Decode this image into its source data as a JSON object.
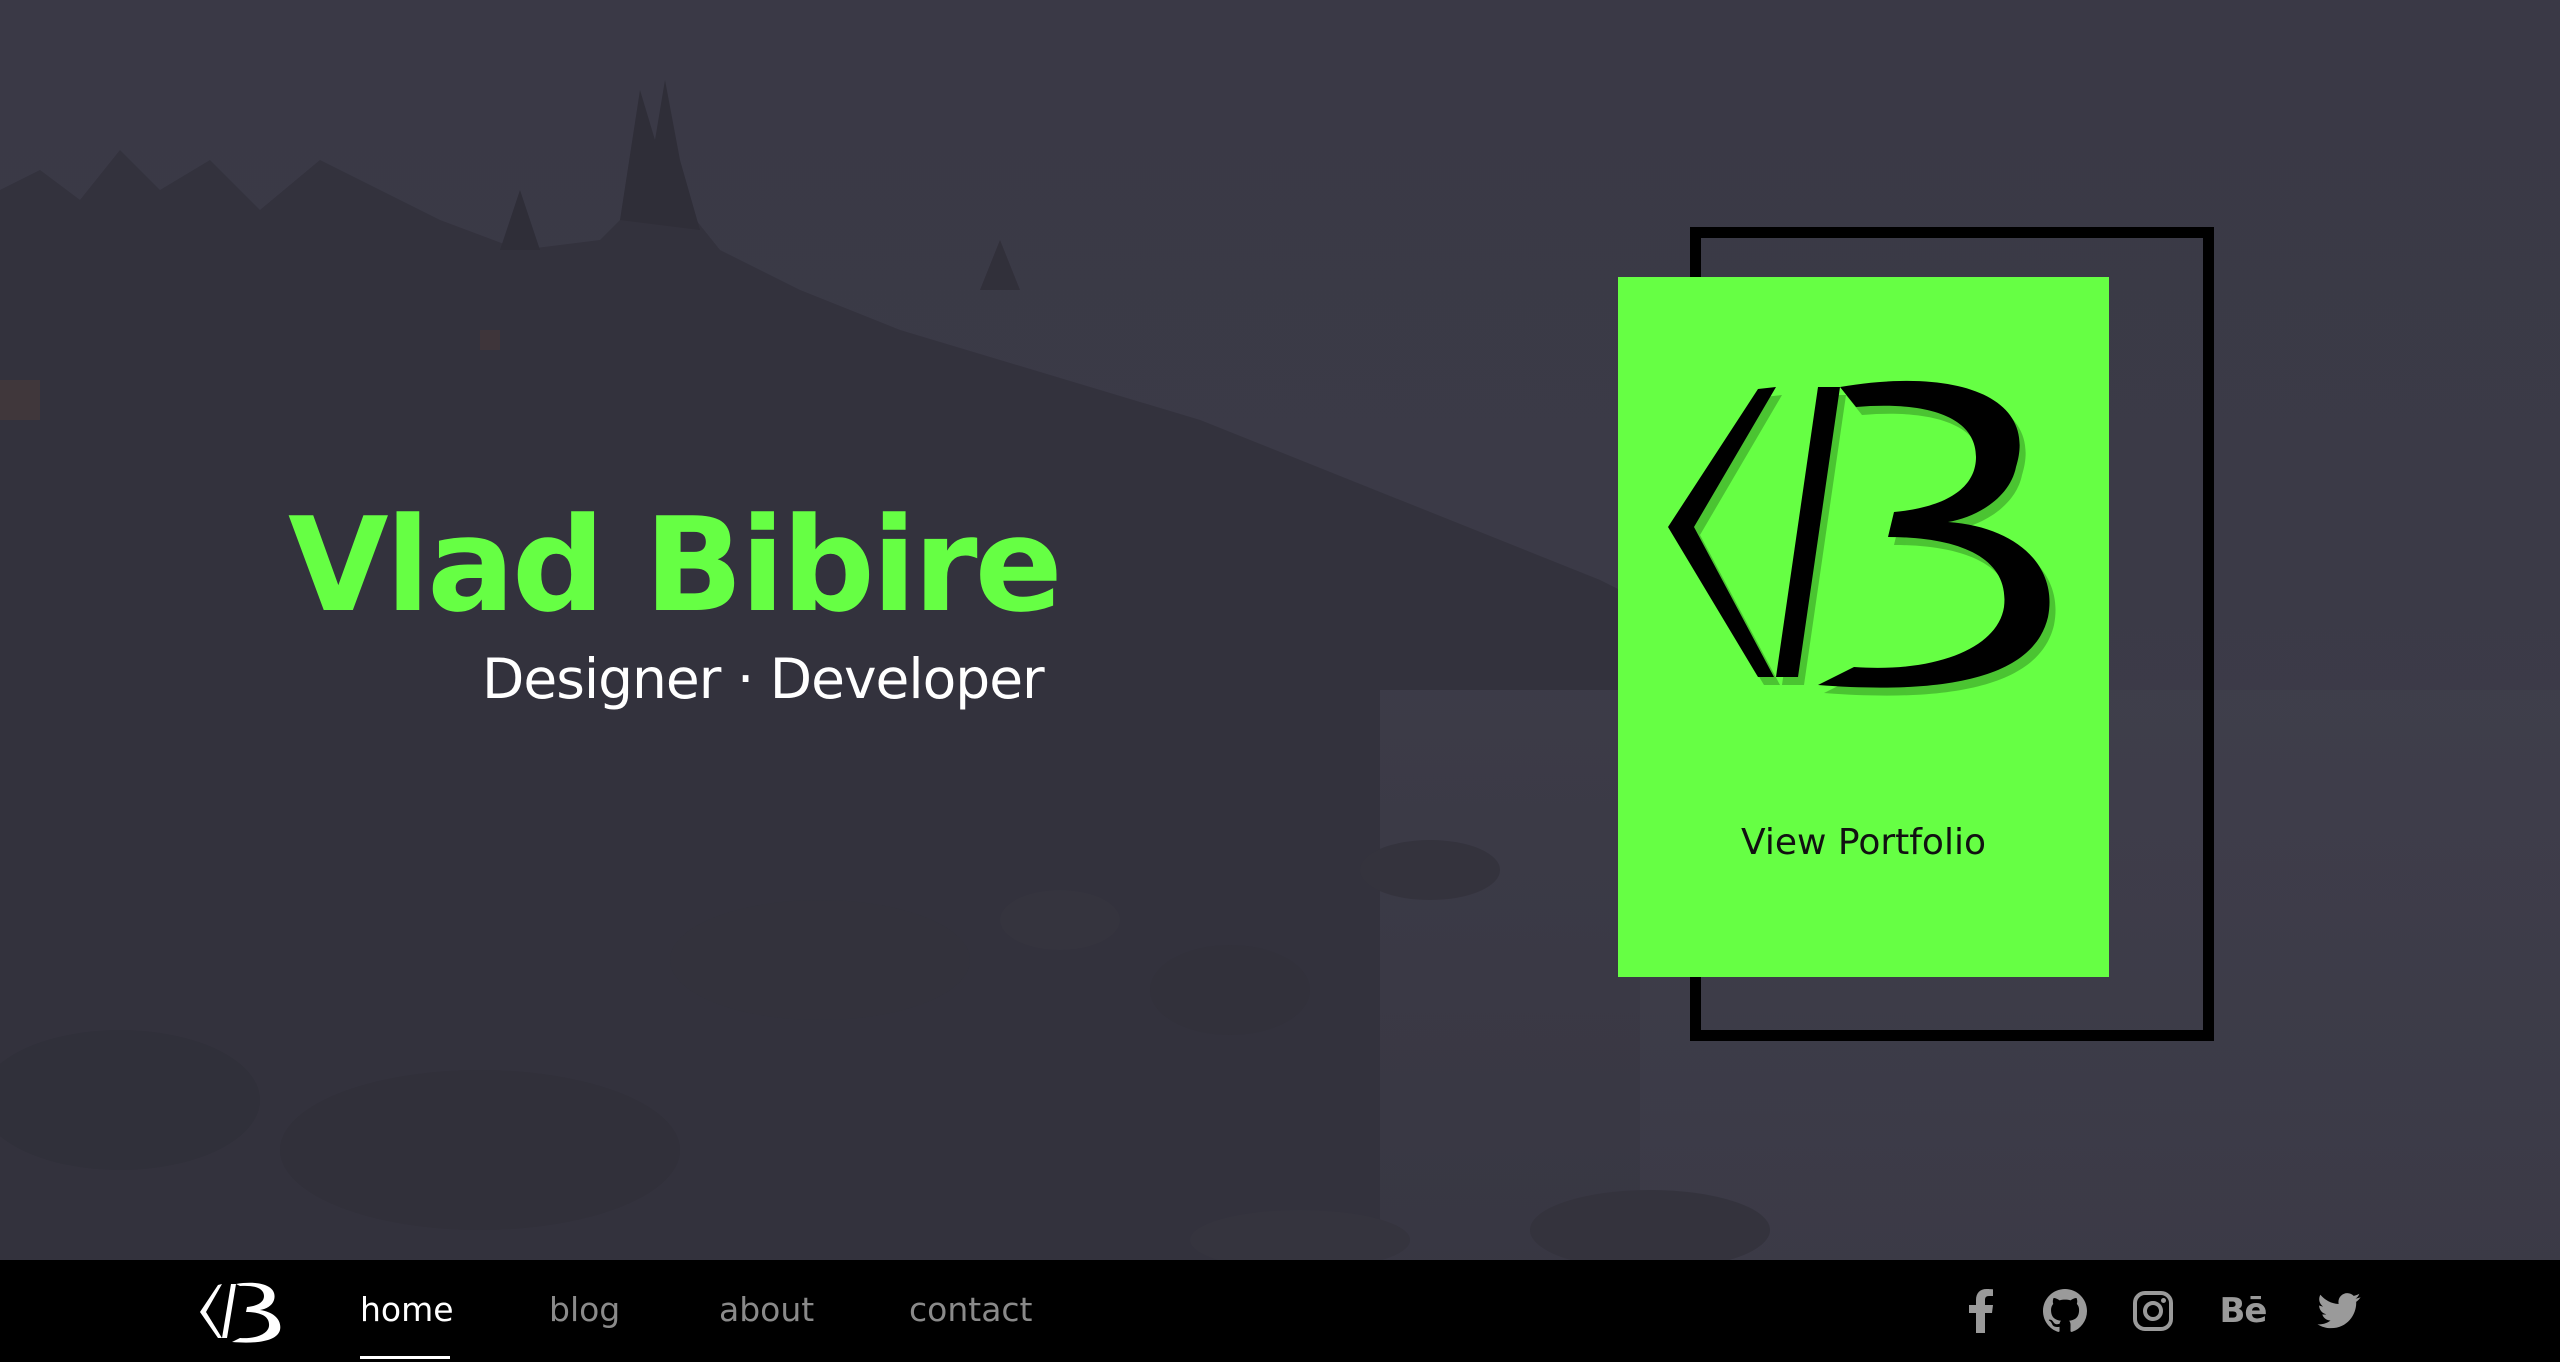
{
  "hero": {
    "title": "Vlad Bibire",
    "subtitle": "Designer · Developer"
  },
  "card": {
    "label": "View Portfolio",
    "logo_icon": "vb-monogram-icon"
  },
  "nav": {
    "logo_icon": "vb-monogram-icon",
    "items": [
      {
        "label": "home",
        "active": true
      },
      {
        "label": "blog",
        "active": false
      },
      {
        "label": "about",
        "active": false
      },
      {
        "label": "contact",
        "active": false
      }
    ]
  },
  "social": {
    "icons": [
      "facebook-icon",
      "github-icon",
      "instagram-icon",
      "behance-icon",
      "twitter-icon"
    ],
    "behance_text": "Bē"
  },
  "colors": {
    "accent": "#66ff44",
    "background": "#3b3a45",
    "footer": "#000000",
    "nav_inactive": "#8a8a8a",
    "nav_active": "#ffffff"
  }
}
